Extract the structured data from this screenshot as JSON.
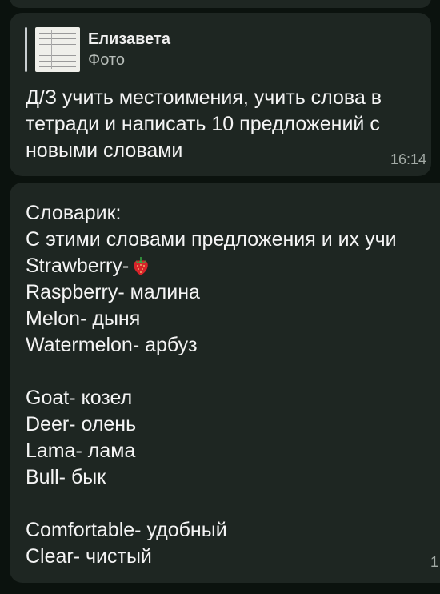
{
  "message1": {
    "reply": {
      "sender": "Елизавета",
      "type_label": "Фото"
    },
    "text": "Д/З учить местоимения, учить слова в тетради и написать 10 предложений с новыми словами",
    "time": "16:14"
  },
  "message2": {
    "lines": [
      "Словарик:",
      "С этими словами предложения и их учи",
      "Strawberry-",
      "Raspberry- малина",
      "Melon- дыня",
      "Watermelon- арбуз",
      "",
      "Goat- козел",
      "Deer- олень",
      "Lama- лама",
      "Bull- бык",
      "",
      "Comfortable- удобный",
      "Clear- чистый"
    ],
    "strawberry_emoji": "strawberry-emoji",
    "time_partial": "1"
  },
  "colors": {
    "background": "#0b120e",
    "bubble": "#1e2622",
    "text": "#f4f4f4",
    "secondary_text": "#b7bdb9",
    "time": "#a2aaa5"
  }
}
